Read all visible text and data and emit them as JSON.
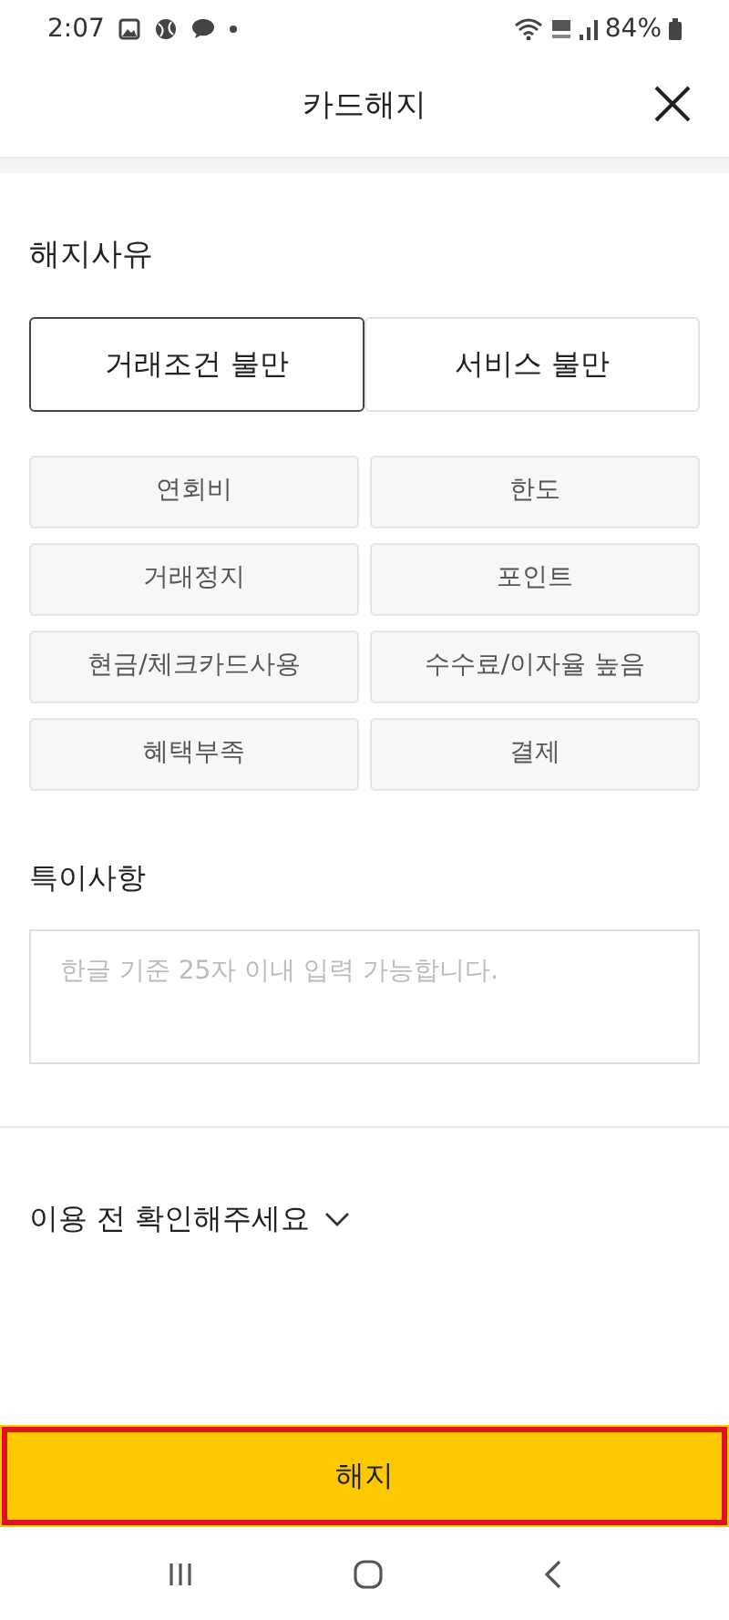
{
  "status_bar": {
    "time": "2:07",
    "battery": "84%"
  },
  "header": {
    "title": "카드해지"
  },
  "reason_section": {
    "title": "해지사유",
    "categories": [
      {
        "label": "거래조건 불만",
        "selected": true
      },
      {
        "label": "서비스 불만",
        "selected": false
      }
    ],
    "options": [
      {
        "label": "연회비",
        "selected": false
      },
      {
        "label": "한도",
        "selected": false
      },
      {
        "label": "거래정지",
        "selected": false
      },
      {
        "label": "포인트",
        "selected": false
      },
      {
        "label": "현금/체크카드사용",
        "selected": false
      },
      {
        "label": "수수료/이자율 높음",
        "selected": false
      },
      {
        "label": "혜택부족",
        "selected": false
      },
      {
        "label": "결제",
        "selected": false
      }
    ]
  },
  "notes": {
    "title": "특이사항",
    "placeholder": "한글 기준 25자 이내 입력 가능합니다."
  },
  "notice": {
    "label": "이용 전 확인해주세요",
    "expanded": false
  },
  "submit": {
    "label": "해지",
    "highlighted": true
  }
}
